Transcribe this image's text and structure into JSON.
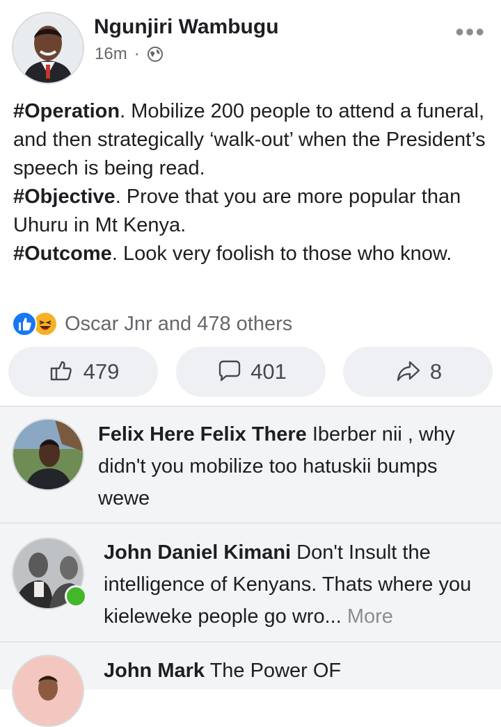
{
  "post": {
    "author": "Ngunjiri Wambugu",
    "time": "16m",
    "separator": "·",
    "privacy_icon": "globe-icon",
    "more_icon": "more-dots-icon",
    "text": {
      "line1_tag": "#Operation",
      "line1_text": ". Mobilize 200 people to attend a funeral, and then strategically ‘walk-out’ when the President’s speech is being read.",
      "line2_tag": "#Objective",
      "line2_text": ". Prove that you are more popular than Uhuru in Mt Kenya.",
      "line3_tag": "#Outcome",
      "line3_text": ". Look very foolish to those who know."
    },
    "reactions_summary": "Oscar Jnr and 478 others",
    "actions": {
      "like_count": "479",
      "comment_count": "401",
      "share_count": "8"
    }
  },
  "comments": [
    {
      "author": "Felix Here Felix There",
      "text": " Iberber nii , why didn't you mobilize too hatuskii bumps wewe"
    },
    {
      "author": "John Daniel Kimani",
      "text": " Don't Insult the intelligence of Kenyans. Thats where you kieleweke people go wro... ",
      "more": "More"
    },
    {
      "author": "John Mark",
      "text": " The Power OF"
    }
  ],
  "colors": {
    "like_blue": "#1877f2",
    "haha_yellow": "#f7b125",
    "online_green": "#42b72a",
    "muted_text": "#65676b"
  }
}
